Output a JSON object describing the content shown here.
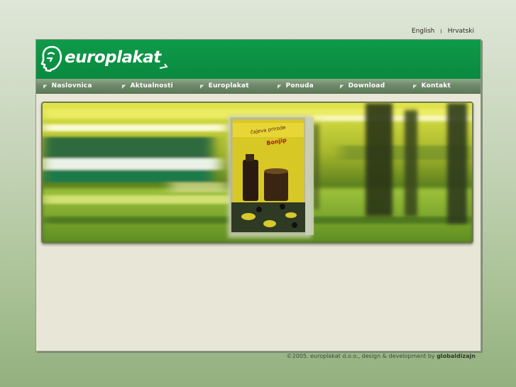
{
  "language_bar": {
    "english": "English",
    "separator": "I",
    "croatian": "Hrvatski"
  },
  "header": {
    "logo_text": "europlakat"
  },
  "nav": {
    "items": [
      {
        "label": "Naslovnica"
      },
      {
        "label": "Aktualnosti"
      },
      {
        "label": "Europlakat"
      },
      {
        "label": "Ponuda"
      },
      {
        "label": "Download"
      },
      {
        "label": "Kontakt"
      }
    ]
  },
  "banner": {
    "poster_text_top": "čajeva prirode",
    "poster_brand": "Bonjip"
  },
  "footer": {
    "copyright": "©2005. europlakat d.o.o., design & development by",
    "credit": "globaldizajn"
  },
  "colors": {
    "header_green": "#0a8a3f",
    "nav_green": "#6e8a6a",
    "content_bg": "#e8e6d6"
  }
}
